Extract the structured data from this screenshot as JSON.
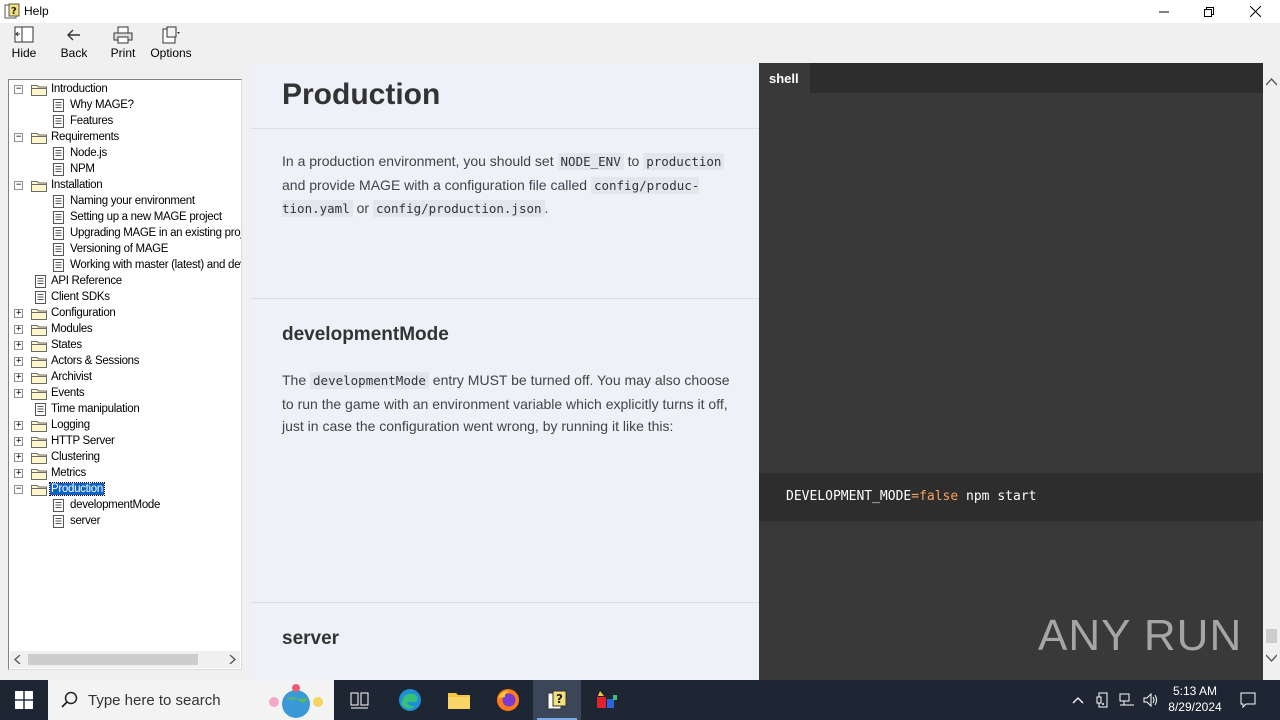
{
  "window": {
    "title": "Help"
  },
  "toolbar": {
    "hide_label": "Hide",
    "back_label": "Back",
    "print_label": "Print",
    "options_label": "Options"
  },
  "tree": [
    {
      "label": "Introduction",
      "level": 0,
      "type": "folder",
      "expander": "minus"
    },
    {
      "label": "Why MAGE?",
      "level": 1,
      "type": "page"
    },
    {
      "label": "Features",
      "level": 1,
      "type": "page"
    },
    {
      "label": "Requirements",
      "level": 0,
      "type": "folder",
      "expander": "minus"
    },
    {
      "label": "Node.js",
      "level": 1,
      "type": "page"
    },
    {
      "label": "NPM",
      "level": 1,
      "type": "page"
    },
    {
      "label": "Installation",
      "level": 0,
      "type": "folder",
      "expander": "minus"
    },
    {
      "label": "Naming your environment",
      "level": 1,
      "type": "page"
    },
    {
      "label": "Setting up a new MAGE project",
      "level": 1,
      "type": "page"
    },
    {
      "label": "Upgrading MAGE in an existing proj",
      "level": 1,
      "type": "page"
    },
    {
      "label": "Versioning of MAGE",
      "level": 1,
      "type": "page"
    },
    {
      "label": "Working with master (latest) and dev",
      "level": 1,
      "type": "page"
    },
    {
      "label": "API Reference",
      "level": 0,
      "type": "page"
    },
    {
      "label": "Client SDKs",
      "level": 0,
      "type": "page"
    },
    {
      "label": "Configuration",
      "level": 0,
      "type": "folder",
      "expander": "plus"
    },
    {
      "label": "Modules",
      "level": 0,
      "type": "folder",
      "expander": "plus"
    },
    {
      "label": "States",
      "level": 0,
      "type": "folder",
      "expander": "plus"
    },
    {
      "label": "Actors & Sessions",
      "level": 0,
      "type": "folder",
      "expander": "plus"
    },
    {
      "label": "Archivist",
      "level": 0,
      "type": "folder",
      "expander": "plus"
    },
    {
      "label": "Events",
      "level": 0,
      "type": "folder",
      "expander": "plus"
    },
    {
      "label": "Time manipulation",
      "level": 0,
      "type": "page"
    },
    {
      "label": "Logging",
      "level": 0,
      "type": "folder",
      "expander": "plus"
    },
    {
      "label": "HTTP Server",
      "level": 0,
      "type": "folder",
      "expander": "plus"
    },
    {
      "label": "Clustering",
      "level": 0,
      "type": "folder",
      "expander": "plus"
    },
    {
      "label": "Metrics",
      "level": 0,
      "type": "folder",
      "expander": "plus"
    },
    {
      "label": "Production",
      "level": 0,
      "type": "folder",
      "expander": "minus",
      "selected": true
    },
    {
      "label": "developmentMode",
      "level": 1,
      "type": "page"
    },
    {
      "label": "server",
      "level": 1,
      "type": "page"
    }
  ],
  "article": {
    "title": "Production",
    "intro": {
      "t1": "In a production environment, you should set ",
      "c1": "NODE_ENV",
      "t2": " to ",
      "c2": "production",
      "t3": " and provide MAGE with a configuration file called ",
      "c3": "config/produc-tion.yaml",
      "t4": " or ",
      "c4": "config/production.json",
      "t5": "."
    },
    "devmode": {
      "heading": "developmentMode",
      "t1": "The ",
      "c1": "developmentMode",
      "t2": " entry MUST be turned off. You may also choose to run the game with an environment variable which explicitly turns it off, just in case the configuration went wrong, by running it like this:"
    },
    "server": {
      "heading": "server"
    }
  },
  "shell": {
    "tab_label": "shell",
    "code_var": "DEVELOPMENT_MODE",
    "code_op": "=",
    "code_bool": "false",
    "code_rest": " npm start"
  },
  "watermark": "ANY RUN",
  "taskbar": {
    "search_placeholder": "Type here to search",
    "time": "5:13 AM",
    "date": "8/29/2024"
  }
}
